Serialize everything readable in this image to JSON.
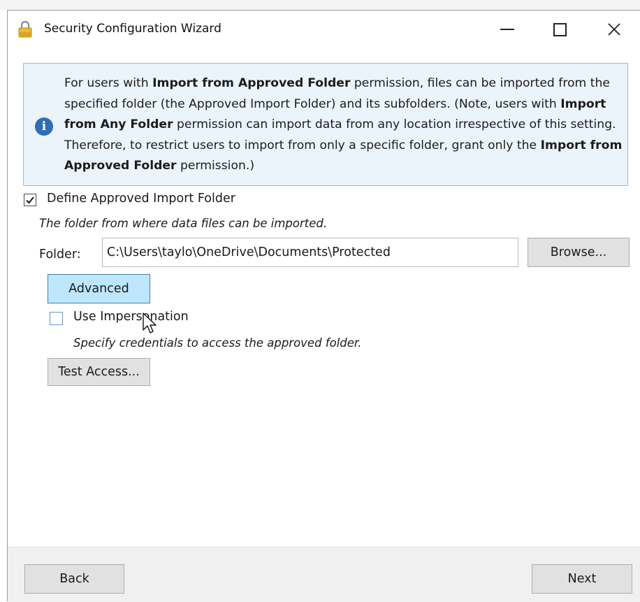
{
  "window": {
    "title": "Security Configuration Wizard",
    "icon": "lock-icon"
  },
  "info": {
    "icon": "info-icon",
    "segments": [
      {
        "text": "For users with ",
        "bold": false
      },
      {
        "text": "Import from Approved Folder",
        "bold": true
      },
      {
        "text": " permission, files can be imported from the specified folder (the Approved Import Folder) and its subfolders. (Note, users with ",
        "bold": false
      },
      {
        "text": "Import from Any Folder",
        "bold": true
      },
      {
        "text": " permission can import data from any location irrespective of this setting. Therefore, to restrict users to import from only a specific folder, grant only the ",
        "bold": false
      },
      {
        "text": "Import from Approved Folder",
        "bold": true
      },
      {
        "text": " permission.)",
        "bold": false
      }
    ]
  },
  "approved_folder": {
    "checkbox_label": "Define Approved Import Folder",
    "checked": true,
    "description": "The folder from where data files can be imported.",
    "folder_label": "Folder:",
    "folder_value": "C:\\Users\\taylo\\OneDrive\\Documents\\Protected",
    "browse_label": "Browse...",
    "advanced_label": "Advanced"
  },
  "impersonation": {
    "checkbox_label": "Use Impersonation",
    "checked": false,
    "description": "Specify credentials to access the approved folder.",
    "test_label": "Test Access..."
  },
  "footer": {
    "back_label": "Back",
    "next_label": "Next"
  },
  "colors": {
    "info_bg": "#ebf3fb",
    "info_border": "#99b9d8",
    "info_icon": "#2f6db5",
    "advanced_bg": "#bee6fd",
    "advanced_border": "#3c7fb1"
  }
}
